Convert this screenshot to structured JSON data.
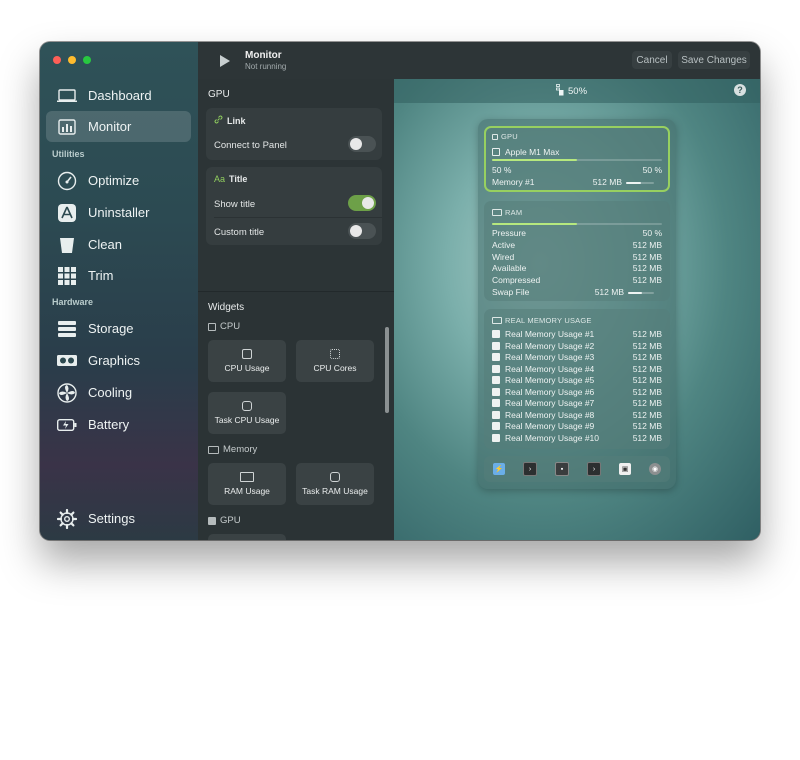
{
  "sidebar": {
    "items": [
      {
        "label": "Dashboard",
        "icon": "laptop-icon"
      },
      {
        "label": "Monitor",
        "icon": "monitor-chart-icon"
      },
      {
        "label": "Optimize",
        "icon": "gauge-icon"
      },
      {
        "label": "Uninstaller",
        "icon": "app-store-icon"
      },
      {
        "label": "Clean",
        "icon": "trash-bin-icon"
      },
      {
        "label": "Trim",
        "icon": "grid-icon"
      },
      {
        "label": "Storage",
        "icon": "storage-icon"
      },
      {
        "label": "Graphics",
        "icon": "gpu-card-icon"
      },
      {
        "label": "Cooling",
        "icon": "fan-icon"
      },
      {
        "label": "Battery",
        "icon": "battery-icon"
      },
      {
        "label": "Settings",
        "icon": "gear-icon"
      }
    ],
    "sections": {
      "utilities": "Utilities",
      "hardware": "Hardware"
    }
  },
  "header": {
    "title": "Monitor",
    "subtitle": "Not running",
    "cancel": "Cancel",
    "save": "Save Changes"
  },
  "config": {
    "section_title": "GPU",
    "link": {
      "title": "Link",
      "connect_label": "Connect to Panel",
      "connect_on": false
    },
    "title_card": {
      "title": "Title",
      "show_title_label": "Show title",
      "show_title_on": true,
      "custom_title_label": "Custom title",
      "custom_title_on": false
    }
  },
  "widgets": {
    "title": "Widgets",
    "cpu": {
      "label": "CPU",
      "items": [
        "CPU Usage",
        "CPU Cores",
        "Task CPU Usage"
      ]
    },
    "memory": {
      "label": "Memory",
      "items": [
        "RAM Usage",
        "Task RAM Usage"
      ]
    },
    "gpu": {
      "label": "GPU"
    }
  },
  "preview": {
    "zoom": "50%",
    "help": "?",
    "gpu": {
      "label": "GPU",
      "device": "Apple M1 Max",
      "usage_left": "50 %",
      "usage_right": "50 %",
      "usage": 0.5,
      "memory_label": "Memory #1",
      "memory_value": "512 MB",
      "memory_fill": 0.55
    },
    "ram": {
      "label": "RAM",
      "fill": 0.5,
      "rows": [
        {
          "k": "Pressure",
          "v": "50 %"
        },
        {
          "k": "Active",
          "v": "512 MB"
        },
        {
          "k": "Wired",
          "v": "512 MB"
        },
        {
          "k": "Available",
          "v": "512 MB"
        },
        {
          "k": "Compressed",
          "v": "512 MB"
        }
      ],
      "swap_label": "Swap File",
      "swap_value": "512 MB",
      "swap_fill": 0.55
    },
    "real": {
      "label": "REAL MEMORY USAGE",
      "rows": [
        {
          "k": "Real Memory Usage #1",
          "v": "512 MB"
        },
        {
          "k": "Real Memory Usage #2",
          "v": "512 MB"
        },
        {
          "k": "Real Memory Usage #3",
          "v": "512 MB"
        },
        {
          "k": "Real Memory Usage #4",
          "v": "512 MB"
        },
        {
          "k": "Real Memory Usage #5",
          "v": "512 MB"
        },
        {
          "k": "Real Memory Usage #6",
          "v": "512 MB"
        },
        {
          "k": "Real Memory Usage #7",
          "v": "512 MB"
        },
        {
          "k": "Real Memory Usage #8",
          "v": "512 MB"
        },
        {
          "k": "Real Memory Usage #9",
          "v": "512 MB"
        },
        {
          "k": "Real Memory Usage #10",
          "v": "512 MB"
        }
      ]
    },
    "tray_icons": [
      "bolt-icon",
      "terminal-icon",
      "chip-icon",
      "terminal-icon",
      "drive-icon",
      "record-icon"
    ]
  },
  "colors": {
    "accent_green": "#6da048",
    "bar_fill": "#b6e87e",
    "selected_border": "#97d060"
  }
}
